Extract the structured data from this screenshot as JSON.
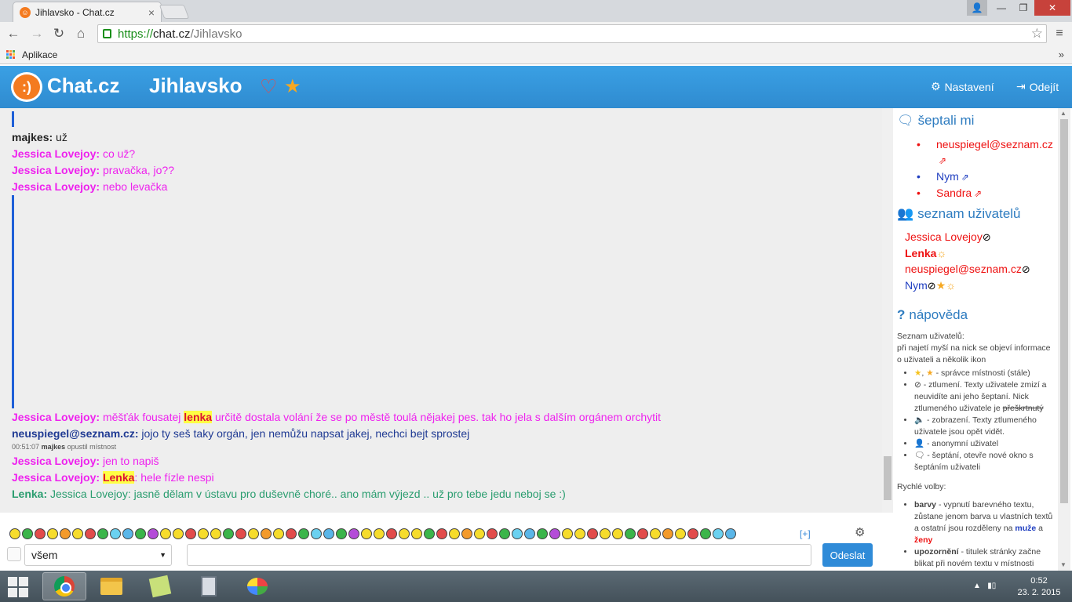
{
  "browser": {
    "tab_title": "Jihlavsko - Chat.cz",
    "url_scheme": "https://",
    "url_host": "chat.cz",
    "url_path": "/Jihlavsko",
    "bookmarks_label": "Aplikace"
  },
  "header": {
    "brand": "Chat.cz",
    "room": "Jihlavsko",
    "settings_label": "Nastavení",
    "logout_label": "Odejít"
  },
  "messages": [
    {
      "nick": "majkes:",
      "text": "už"
    },
    {
      "nick": "Jessica Lovejoy:",
      "text": "co už?"
    },
    {
      "nick": "Jessica Lovejoy:",
      "text": "pravačka, jo??"
    },
    {
      "nick": "Jessica Lovejoy:",
      "text": "nebo levačka"
    },
    {
      "nick": "Jessica Lovejoy:",
      "pre": "měšťák fousatej ",
      "mention": "lenka",
      "post": " určitě dostala volání že se po městě toulá nějakej pes. tak ho jela s dalším orgánem orchytit"
    },
    {
      "nick": "neuspiegel@seznam.cz:",
      "text": "jojo ty seš taky orgán, jen nemůžu napsat jakej, nechci bejt sprostej"
    },
    {
      "nick": "Jessica Lovejoy:",
      "text": "jen to napiš"
    },
    {
      "nick": "Jessica Lovejoy:",
      "mention": "Lenka",
      "post": ": hele fízle nespi"
    },
    {
      "nick": "Lenka:",
      "text": "Jessica Lovejoy: jasně dělam v ústavu pro duševně choré.. ano mám výjezd  .. už pro tebe jedu neboj se :)"
    }
  ],
  "system_msg": {
    "time": "00:51:07",
    "who": "majkes",
    "text": "opustil místnost"
  },
  "sidebar": {
    "whisper_title": "šeptali mi",
    "whispers": [
      "neuspiegel@seznam.cz",
      "Nym",
      "Sandra"
    ],
    "users_title": "seznam uživatelů",
    "users": [
      "Jessica Lovejoy",
      "Lenka",
      "neuspiegel@seznam.cz",
      "Nym"
    ],
    "help_title": "nápověda",
    "help_intro_title": "Seznam uživatelů:",
    "help_intro": "při najetí myší na nick se objeví informace o uživateli a několik ikon",
    "help_items": [
      "- správce místnosti (stále)",
      "- ztlumení. Texty uživatele zmizí a neuvidíte ani jeho šeptaní. Nick ztlumeného uživatele je",
      "přeškrtnutý",
      "- zobrazení. Texty ztlumeného uživatele jsou opět vidět.",
      "- anonymní uživatel",
      "- šeptání, otevře nové okno s šeptáním uživateli"
    ],
    "quick_title": "Rychlé volby:",
    "quick_items": [
      {
        "term": "barvy",
        "desc": " - vypnutí barevného textu, zůstane jenom barva u vlastních textů a ostatní jsou rozděleny na ",
        "b1": "muže",
        "mid": " a ",
        "b2": "ženy"
      },
      {
        "term": "upozornění",
        "desc": " - titulek stránky začne blikat při novém textu v místnosti"
      }
    ]
  },
  "composer": {
    "more_emotes": "[+]",
    "target": "všem",
    "send_label": "Odeslat",
    "input_value": ""
  },
  "taskbar": {
    "time": "0:52",
    "date": "23. 2. 2015"
  },
  "colors": {
    "header": "#2f8bd0",
    "accent": "#f47b20",
    "jessica": "#ee22ee",
    "neuspiegel": "#1f3a93",
    "lenka": "#2a9d6f"
  }
}
